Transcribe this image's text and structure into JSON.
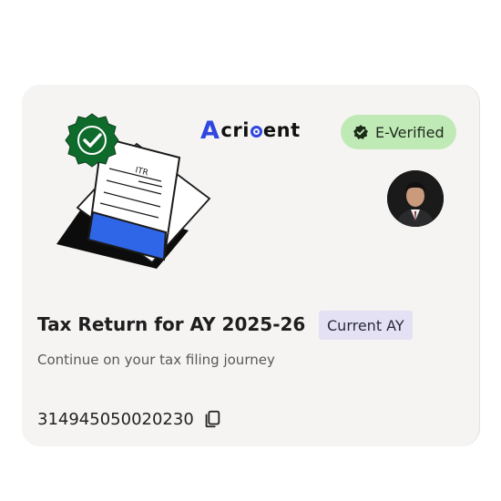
{
  "card": {
    "doc_label": "ITR",
    "brand": {
      "initial": "A",
      "part1": "cri",
      "part2": "ent"
    },
    "badge": {
      "label": "E-Verified",
      "icon": "verified-check-icon"
    },
    "avatar": "user-avatar-photo",
    "title": "Tax Return for AY 2025-26",
    "chip": "Current AY",
    "subtitle": "Continue on your tax filing journey",
    "acknowledgement": "314945050020230",
    "copy_icon": "copy-icon"
  },
  "colors": {
    "card_bg": "#f6f4f3",
    "badge_bg": "#bfeab6",
    "chip_bg": "#e3e1f3",
    "brand_blue": "#2f46e0",
    "seal_green": "#0f6b2c"
  }
}
